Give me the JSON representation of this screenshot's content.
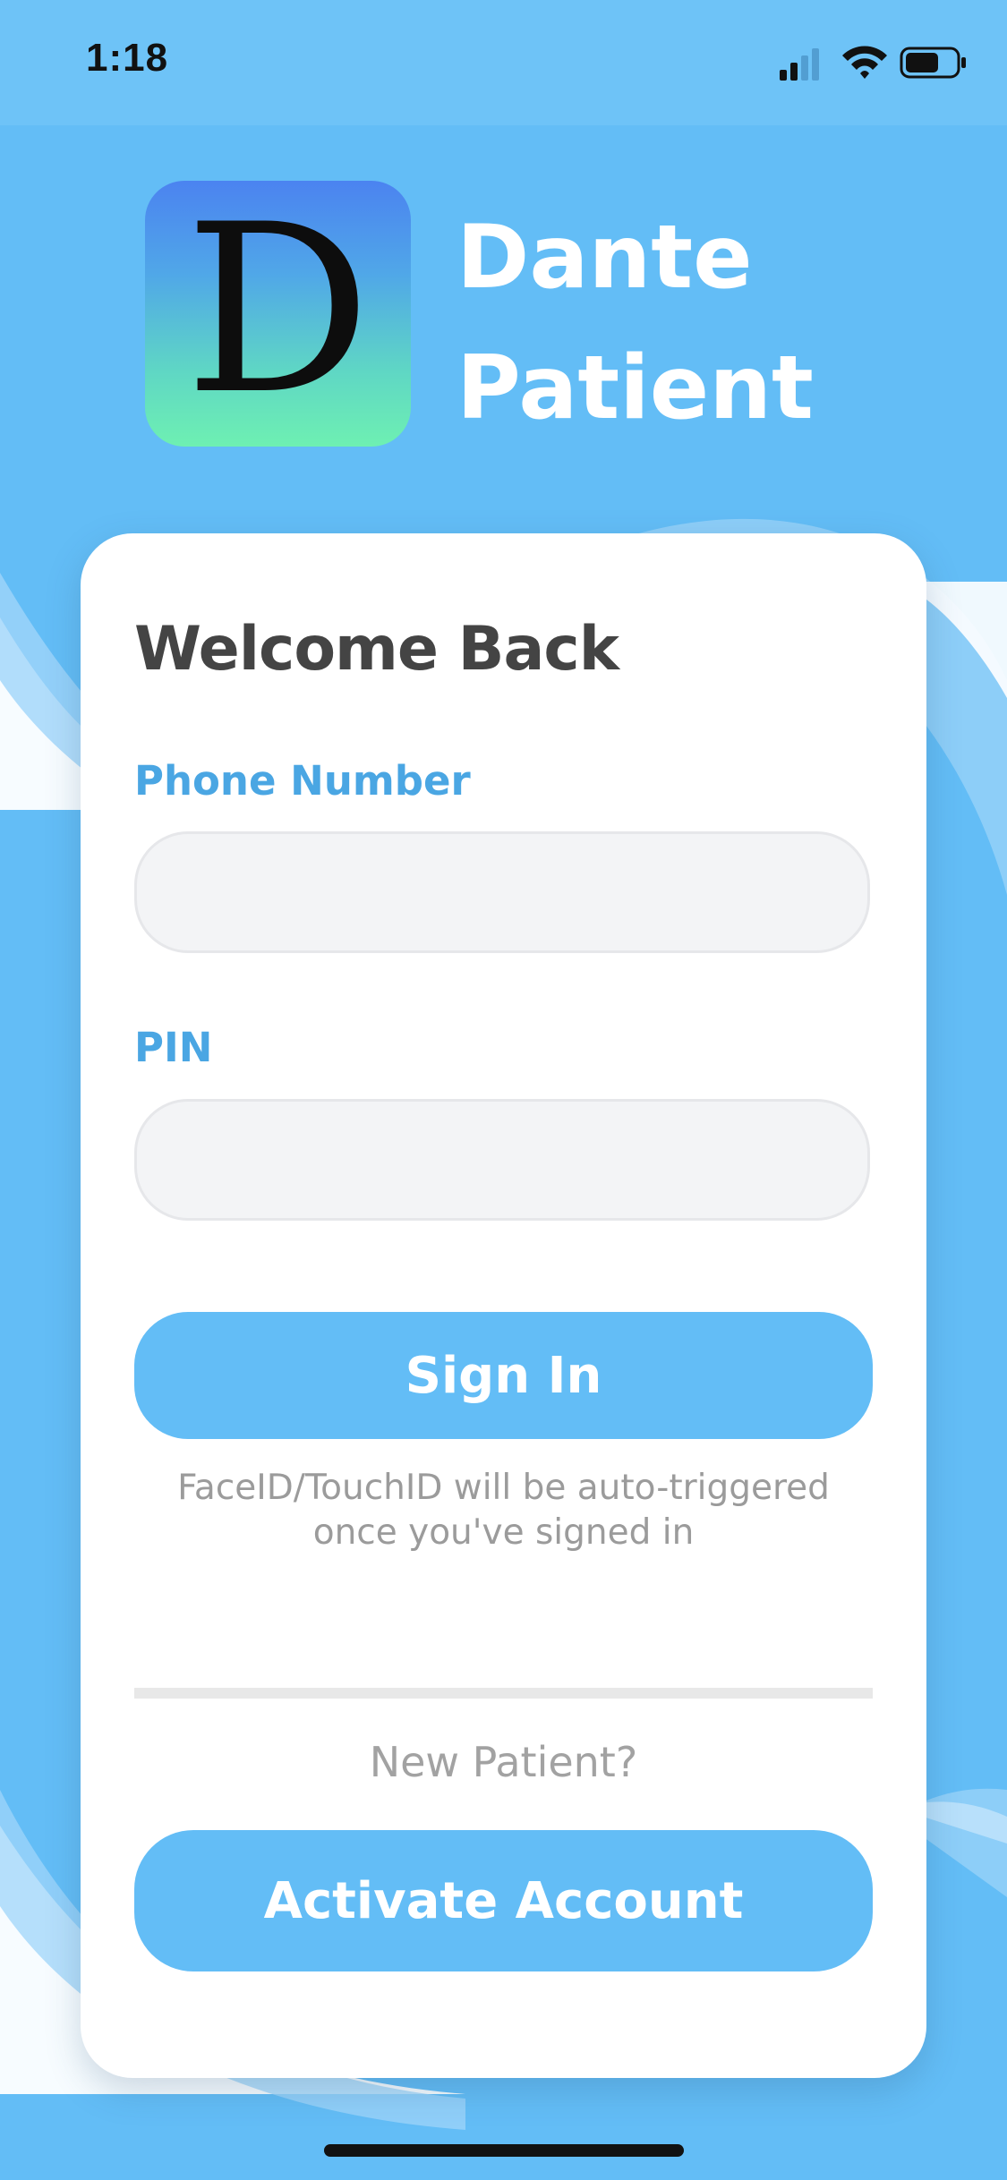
{
  "status_bar": {
    "time": "1:18"
  },
  "header": {
    "logo_letter": "D",
    "app_name_line1": "Dante",
    "app_name_line2": "Patient"
  },
  "login_card": {
    "title": "Welcome Back",
    "phone_label": "Phone Number",
    "phone_value": "",
    "phone_placeholder": "",
    "pin_label": "PIN",
    "pin_value": "",
    "pin_placeholder": "",
    "sign_in_label": "Sign In",
    "biometric_hint_line1": "FaceID/TouchID will be auto-triggered",
    "biometric_hint_line2": "once you've signed in",
    "new_patient_text": "New Patient?",
    "activate_label": "Activate Account"
  },
  "colors": {
    "background": "#63bdf6",
    "accent_blue": "#4aa6e3",
    "button_blue": "#63bdf6",
    "card": "#ffffff",
    "title_gray": "#444444"
  },
  "icons": {
    "signal": "cellular-signal-icon",
    "wifi": "wifi-icon",
    "battery": "battery-icon"
  }
}
